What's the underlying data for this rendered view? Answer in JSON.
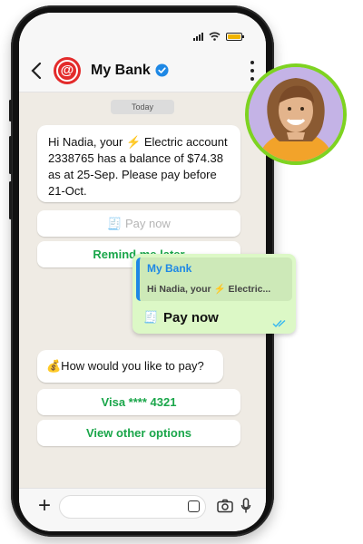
{
  "header": {
    "title": "My Bank",
    "back_icon": "back-arrow-icon",
    "verified_icon": "verified-badge-icon",
    "menu_icon": "kebab-menu-icon"
  },
  "chat": {
    "date_chip": "Today",
    "message1": {
      "prefix": "Hi Nadia, your",
      "emoji": "⚡",
      "suffix": "Electric account 2338765 has a balance of $74.38 as at 25-Sep. Please pay before 21-Oct."
    },
    "buttons1": [
      {
        "label": "🧾 Pay now"
      },
      {
        "label": "Remind me later"
      }
    ],
    "message2": {
      "text": "💰How would you like to pay?"
    },
    "buttons2": [
      {
        "label": "Visa **** 4321"
      },
      {
        "label": "View other options"
      }
    ]
  },
  "reply": {
    "quote_name": "My Bank",
    "quote_prefix": "Hi Nadia, your",
    "quote_emoji": "⚡",
    "quote_suffix": "Electric...",
    "pay_label": "Pay now",
    "receipt_icon": "receipt-icon"
  },
  "colors": {
    "accent_green": "#1aa64a",
    "reply_bg": "#dcf8c6",
    "quote_bar": "#1e88e5",
    "logo_red": "#e32b2b",
    "photo_ring": "#7ed321"
  }
}
